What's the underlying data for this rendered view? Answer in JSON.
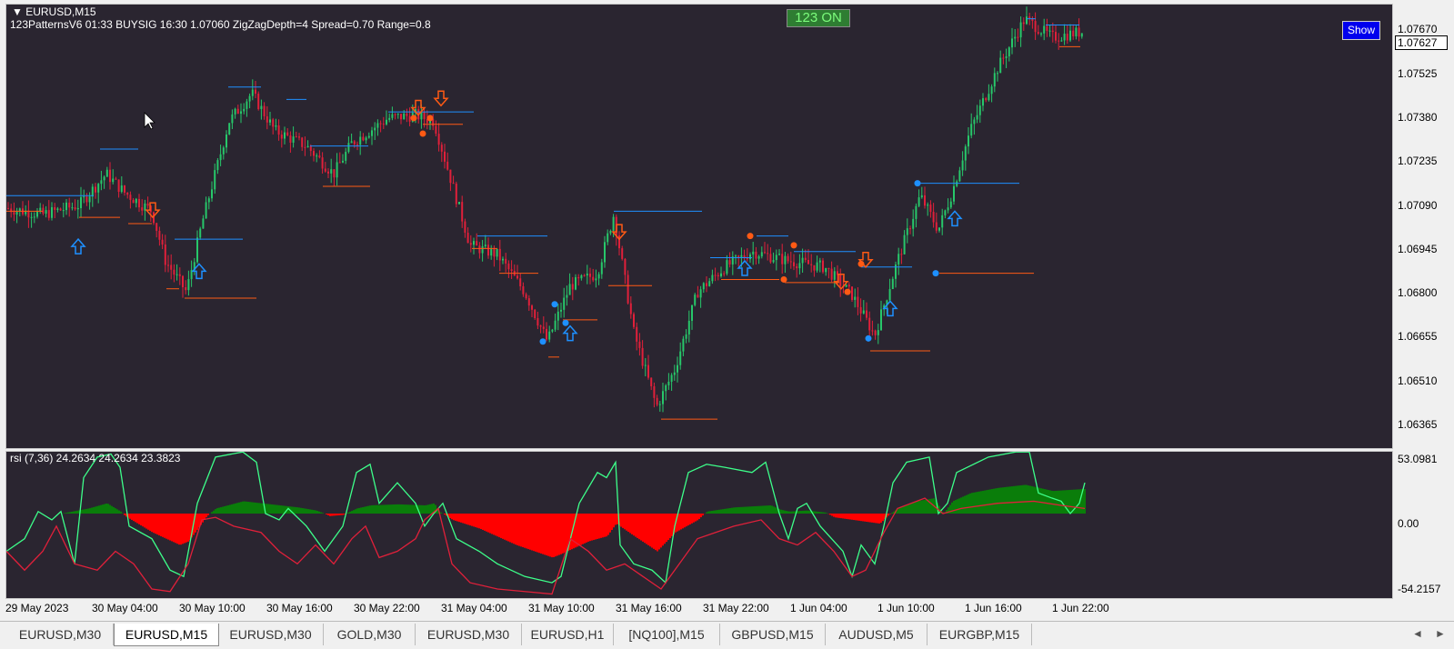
{
  "chart_header": {
    "symbol": "EURUSD,M15",
    "indicator_info": "123PatternsV6  01:33  BUYSIG  16:30  1.07060  ZigZagDepth=4  Spread=0.70  Range=0.8",
    "status_badge": "123 ON",
    "show_button": "Show",
    "current_price": "1.07627"
  },
  "price_axis": [
    "1.07670",
    "1.07525",
    "1.07380",
    "1.07235",
    "1.07090",
    "1.06945",
    "1.06800",
    "1.06655",
    "1.06510",
    "1.06365"
  ],
  "indicator": {
    "label": "rsi  (7,36) 24.2634 24.2634 23.3823",
    "axis": [
      "53.0981",
      "0.00",
      "-54.2157"
    ]
  },
  "time_axis": [
    "29 May 2023",
    "30 May 04:00",
    "30 May 10:00",
    "30 May 16:00",
    "30 May 22:00",
    "31 May 04:00",
    "31 May 10:00",
    "31 May 16:00",
    "31 May 22:00",
    "1 Jun 04:00",
    "1 Jun 10:00",
    "1 Jun 16:00",
    "1 Jun 22:00"
  ],
  "tabs": [
    "EURUSD,M30",
    "EURUSD,M15",
    "EURUSD,M30",
    "GOLD,M30",
    "EURUSD,M30",
    "EURUSD,H1",
    "[NQ100],M15",
    "GBPUSD,M15",
    "AUDUSD,M5",
    "EURGBP,M15"
  ],
  "active_tab": 1,
  "colors": {
    "background": "#2a2530",
    "bull": "#27c76a",
    "bear": "#e0203a",
    "buy_marker": "#1e90ff",
    "sell_marker": "#ff5a14",
    "hist_pos": "#0a7d0a",
    "hist_neg": "#ff0000",
    "rsi_fast": "#3dff8a",
    "rsi_slow": "#e0203a"
  },
  "chart_data": {
    "type": "line",
    "x": [
      "29 May 2023",
      "30 May 04:00",
      "30 May 10:00",
      "30 May 16:00",
      "30 May 22:00",
      "31 May 04:00",
      "31 May 10:00",
      "31 May 16:00",
      "31 May 22:00",
      "1 Jun 04:00",
      "1 Jun 10:00",
      "1 Jun 16:00",
      "1 Jun 22:00"
    ],
    "series": [
      {
        "values": [
          1.0707,
          1.0718,
          1.0704,
          1.0744,
          1.0738,
          1.0734,
          1.0677,
          1.0707,
          1.0692,
          1.0693,
          1.0666,
          1.0742,
          1.0764
        ]
      }
    ],
    "ylim": [
      1.0632,
      1.0772
    ]
  }
}
